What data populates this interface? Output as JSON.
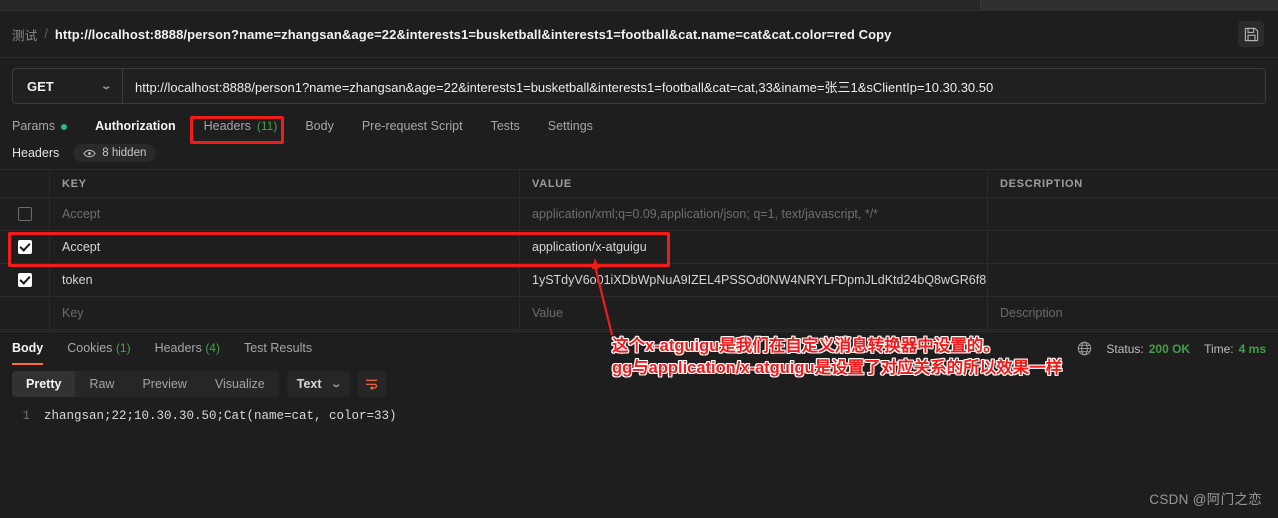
{
  "breadcrumb": {
    "collection": "测试",
    "separator": "/",
    "title": "http://localhost:8888/person?name=zhangsan&age=22&interests1=busketball&interests1=football&cat.name=cat&cat.color=red Copy",
    "save_icon": "save-floppy-icon"
  },
  "request": {
    "method": "GET",
    "method_caret": "⌄",
    "url": "http://localhost:8888/person1?name=zhangsan&age=22&interests1=busketball&interests1=football&cat=cat,33&iname=张三1&sClientIp=10.30.30.50"
  },
  "request_tabs": [
    {
      "label": "Params",
      "dot": true,
      "count": "",
      "active": false
    },
    {
      "label": "Authorization",
      "dot": false,
      "count": "",
      "active": true
    },
    {
      "label": "Headers",
      "dot": false,
      "count": "(11)",
      "active": false,
      "highlighted": true
    },
    {
      "label": "Body",
      "dot": false,
      "count": "",
      "active": false
    },
    {
      "label": "Pre-request Script",
      "dot": false,
      "count": "",
      "active": false
    },
    {
      "label": "Tests",
      "dot": false,
      "count": "",
      "active": false
    },
    {
      "label": "Settings",
      "dot": false,
      "count": "",
      "active": false
    }
  ],
  "headers_sub": {
    "label": "Headers",
    "hidden_pill": "8 hidden",
    "eye_icon": "eye-icon"
  },
  "headers_table": {
    "columns": [
      "KEY",
      "VALUE",
      "DESCRIPTION"
    ],
    "rows": [
      {
        "checked": false,
        "key": "Accept",
        "value": "application/xml;q=0.09,application/json; q=1, text/javascript, */*",
        "description": "",
        "muted": true,
        "highlighted": false
      },
      {
        "checked": true,
        "key": "Accept",
        "value": "application/x-atguigu",
        "description": "",
        "muted": false,
        "highlighted": true
      },
      {
        "checked": true,
        "key": "token",
        "value": "1ySTdyV6o01iXDbWpNuA9IZEL4PSSOd0NW4NRYLFDpmJLdKtd24bQ8wGR6f8...",
        "description": "",
        "muted": false,
        "highlighted": false
      }
    ],
    "placeholder_row": {
      "key": "Key",
      "value": "Value",
      "description": "Description"
    }
  },
  "response_tabs": [
    {
      "label": "Body",
      "count": "",
      "active": true
    },
    {
      "label": "Cookies",
      "count": "(1)",
      "active": false
    },
    {
      "label": "Headers",
      "count": "(4)",
      "active": false
    },
    {
      "label": "Test Results",
      "count": "",
      "active": false
    }
  ],
  "response_status": {
    "globe_icon": "globe-icon",
    "status_label": "Status:",
    "status_value": "200 OK",
    "time_label": "Time:",
    "time_value": "4 ms"
  },
  "body_toolbar": {
    "views": [
      {
        "label": "Pretty",
        "active": true
      },
      {
        "label": "Raw",
        "active": false
      },
      {
        "label": "Preview",
        "active": false
      },
      {
        "label": "Visualize",
        "active": false
      }
    ],
    "format": "Text",
    "format_caret": "⌄",
    "wrap_icon": "wrap-lines-icon"
  },
  "response_body": {
    "line_number": "1",
    "content": "zhangsan;22;10.30.30.50;Cat(name=cat, color=33)"
  },
  "annotation": {
    "line1": "这个x-atguigu是我们在自定义消息转换器中设置的。",
    "line2": "gg与application/x-atguigu是设置了对应关系的所以效果一样",
    "color": "#f01c1c"
  },
  "watermark": "CSDN @阿门之恋",
  "theme": {
    "background": "#1e1e1e",
    "accent": "#ff6c37",
    "success": "#43a047",
    "highlight": "#f01c1c"
  }
}
